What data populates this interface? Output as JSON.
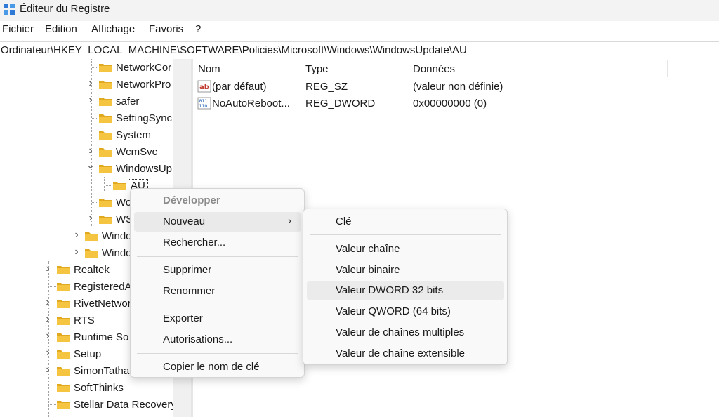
{
  "window": {
    "title": "Éditeur du Registre"
  },
  "menu": [
    "Fichier",
    "Edition",
    "Affichage",
    "Favoris",
    "?"
  ],
  "address": "Ordinateur\\HKEY_LOCAL_MACHINE\\SOFTWARE\\Policies\\Microsoft\\Windows\\WindowsUpdate\\AU",
  "tree": {
    "items": [
      {
        "label": "NetworkCor",
        "expander": "",
        "level": 2
      },
      {
        "label": "NetworkPro",
        "expander": "collapsed",
        "level": 2
      },
      {
        "label": "safer",
        "expander": "collapsed",
        "level": 2
      },
      {
        "label": "SettingSync",
        "expander": "",
        "level": 2
      },
      {
        "label": "System",
        "expander": "",
        "level": 2
      },
      {
        "label": "WcmSvc",
        "expander": "collapsed",
        "level": 2
      },
      {
        "label": "WindowsUp",
        "expander": "expanded",
        "level": 2
      },
      {
        "label": "AU",
        "expander": "",
        "level": 3,
        "selected": true
      },
      {
        "label": "Wo",
        "expander": "",
        "level": 2
      },
      {
        "label": "WS",
        "expander": "collapsed",
        "level": 2
      },
      {
        "label": "Windo",
        "expander": "collapsed",
        "level": 1
      },
      {
        "label": "Windo",
        "expander": "collapsed",
        "level": 1
      },
      {
        "label": "Realtek",
        "expander": "collapsed",
        "level": 0
      },
      {
        "label": "RegisteredA",
        "expander": "",
        "level": 0
      },
      {
        "label": "RivetNetwor",
        "expander": "collapsed",
        "level": 0
      },
      {
        "label": "RTS",
        "expander": "collapsed",
        "level": 0
      },
      {
        "label": "Runtime So",
        "expander": "collapsed",
        "level": 0
      },
      {
        "label": "Setup",
        "expander": "collapsed",
        "level": 0
      },
      {
        "label": "SimonTatha",
        "expander": "collapsed",
        "level": 0
      },
      {
        "label": "SoftThinks",
        "expander": "",
        "level": 0
      },
      {
        "label": "Stellar Data Recovery",
        "expander": "",
        "level": 0
      }
    ]
  },
  "list": {
    "columns": [
      "Nom",
      "Type",
      "Données"
    ],
    "rows": [
      {
        "icon": "string-value-icon",
        "name": "(par défaut)",
        "type": "REG_SZ",
        "data": "(valeur non définie)"
      },
      {
        "icon": "dword-value-icon",
        "name": "NoAutoReboot...",
        "type": "REG_DWORD",
        "data": "0x00000000 (0)"
      }
    ]
  },
  "context_menu": {
    "developper": "Développer",
    "nouveau": "Nouveau",
    "rechercher": "Rechercher...",
    "supprimer": "Supprimer",
    "renommer": "Renommer",
    "exporter": "Exporter",
    "autorisations": "Autorisations...",
    "copier": "Copier le nom de clé"
  },
  "submenu": {
    "items": [
      "Clé",
      "Valeur chaîne",
      "Valeur binaire",
      "Valeur DWORD 32 bits",
      "Valeur QWORD (64 bits)",
      "Valeur de chaînes multiples",
      "Valeur de chaîne extensible"
    ],
    "highlighted": "Valeur DWORD 32 bits"
  },
  "colors": {
    "folder": "#f5c542",
    "folder_dark": "#e0a91f",
    "hover": "#ebebeb"
  }
}
